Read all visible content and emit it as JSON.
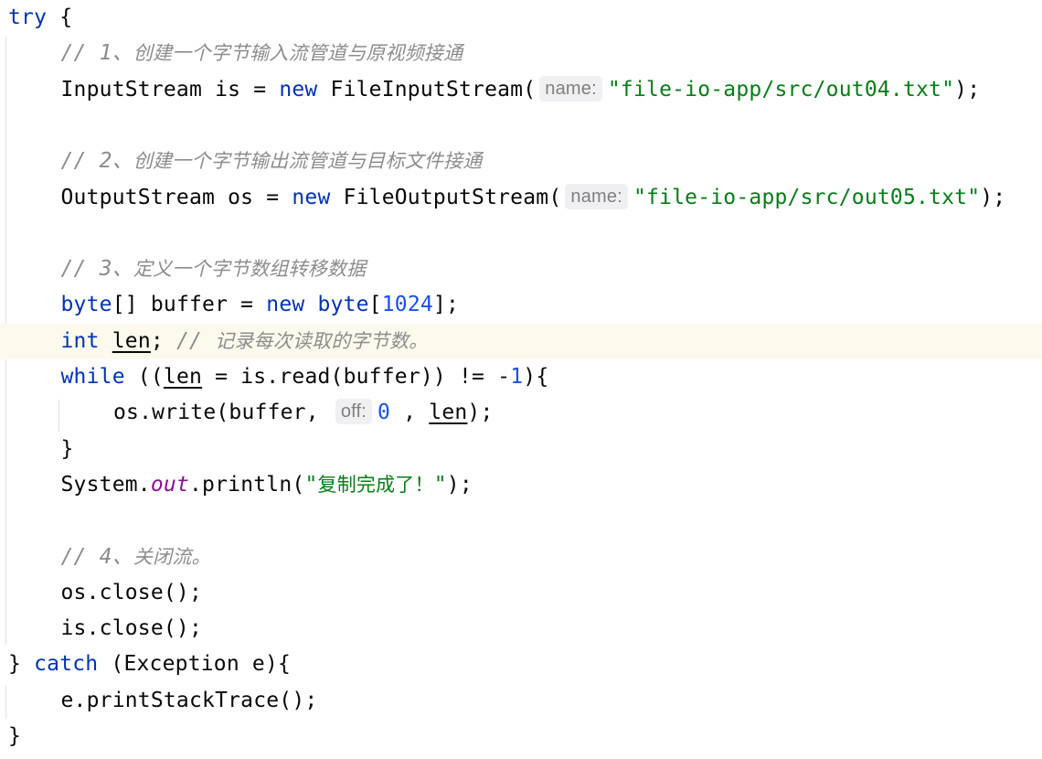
{
  "editor": {
    "lines": [
      {
        "indent": 0,
        "tokens": [
          {
            "t": "kw",
            "v": "try"
          },
          {
            "t": "p",
            "v": " {"
          }
        ]
      },
      {
        "indent": 1,
        "tokens": [
          {
            "t": "cm",
            "v": "// 1、"
          },
          {
            "t": "cm-cjk",
            "v": "创建一个字节输入流管道与原视频接通"
          }
        ]
      },
      {
        "indent": 1,
        "tokens": [
          {
            "t": "p",
            "v": "InputStream is = "
          },
          {
            "t": "kw",
            "v": "new"
          },
          {
            "t": "p",
            "v": " FileInputStream("
          },
          {
            "t": "hint",
            "v": "name:"
          },
          {
            "t": "str",
            "v": "\"file-io-app/src/out04.txt\""
          },
          {
            "t": "p",
            "v": ");"
          }
        ]
      },
      {
        "indent": 0,
        "tokens": []
      },
      {
        "indent": 1,
        "tokens": [
          {
            "t": "cm",
            "v": "// 2、"
          },
          {
            "t": "cm-cjk",
            "v": "创建一个字节输出流管道与目标文件接通"
          }
        ]
      },
      {
        "indent": 1,
        "tokens": [
          {
            "t": "p",
            "v": "OutputStream os = "
          },
          {
            "t": "kw",
            "v": "new"
          },
          {
            "t": "p",
            "v": " FileOutputStream("
          },
          {
            "t": "hint",
            "v": "name:"
          },
          {
            "t": "str",
            "v": "\"file-io-app/src/out05.txt\""
          },
          {
            "t": "p",
            "v": ");"
          }
        ]
      },
      {
        "indent": 0,
        "tokens": []
      },
      {
        "indent": 1,
        "tokens": [
          {
            "t": "cm",
            "v": "// 3、"
          },
          {
            "t": "cm-cjk",
            "v": "定义一个字节数组转移数据"
          }
        ]
      },
      {
        "indent": 1,
        "tokens": [
          {
            "t": "kw",
            "v": "byte"
          },
          {
            "t": "p",
            "v": "[] buffer = "
          },
          {
            "t": "kw",
            "v": "new byte"
          },
          {
            "t": "p",
            "v": "["
          },
          {
            "t": "num",
            "v": "1024"
          },
          {
            "t": "p",
            "v": "];"
          }
        ]
      },
      {
        "indent": 1,
        "highlight": true,
        "tokens": [
          {
            "t": "kw",
            "v": "int"
          },
          {
            "t": "p",
            "v": " "
          },
          {
            "t": "ul",
            "v": "len"
          },
          {
            "t": "p",
            "v": "; "
          },
          {
            "t": "cm",
            "v": "// "
          },
          {
            "t": "cm-cjk",
            "v": "记录每次读取的字节数。"
          }
        ]
      },
      {
        "indent": 1,
        "tokens": [
          {
            "t": "kw",
            "v": "while"
          },
          {
            "t": "p",
            "v": " (("
          },
          {
            "t": "ul",
            "v": "len"
          },
          {
            "t": "p",
            "v": " = is.read(buffer)) != -"
          },
          {
            "t": "num",
            "v": "1"
          },
          {
            "t": "p",
            "v": "){"
          }
        ]
      },
      {
        "indent": 2,
        "tokens": [
          {
            "t": "p",
            "v": "os.write(buffer, "
          },
          {
            "t": "hint",
            "v": "off:"
          },
          {
            "t": "num",
            "v": "0"
          },
          {
            "t": "p",
            "v": " , "
          },
          {
            "t": "ul",
            "v": "len"
          },
          {
            "t": "p",
            "v": ");"
          }
        ]
      },
      {
        "indent": 1,
        "tokens": [
          {
            "t": "p",
            "v": "}"
          }
        ]
      },
      {
        "indent": 1,
        "tokens": [
          {
            "t": "p",
            "v": "System."
          },
          {
            "t": "field",
            "v": "out"
          },
          {
            "t": "p",
            "v": ".println("
          },
          {
            "t": "str",
            "v": "\""
          },
          {
            "t": "str-cjk",
            "v": "复制完成了！"
          },
          {
            "t": "str",
            "v": "\""
          },
          {
            "t": "p",
            "v": ");"
          }
        ]
      },
      {
        "indent": 0,
        "tokens": []
      },
      {
        "indent": 1,
        "tokens": [
          {
            "t": "cm",
            "v": "// 4、"
          },
          {
            "t": "cm-cjk",
            "v": "关闭流。"
          }
        ]
      },
      {
        "indent": 1,
        "tokens": [
          {
            "t": "p",
            "v": "os.close();"
          }
        ]
      },
      {
        "indent": 1,
        "tokens": [
          {
            "t": "p",
            "v": "is.close();"
          }
        ]
      },
      {
        "indent": 0,
        "tokens": [
          {
            "t": "p",
            "v": "} "
          },
          {
            "t": "kw",
            "v": "catch"
          },
          {
            "t": "p",
            "v": " (Exception e){"
          }
        ]
      },
      {
        "indent": 1,
        "tokens": [
          {
            "t": "p",
            "v": "e.printStackTrace();"
          }
        ]
      },
      {
        "indent": 0,
        "tokens": [
          {
            "t": "p",
            "v": "}"
          }
        ]
      }
    ]
  }
}
